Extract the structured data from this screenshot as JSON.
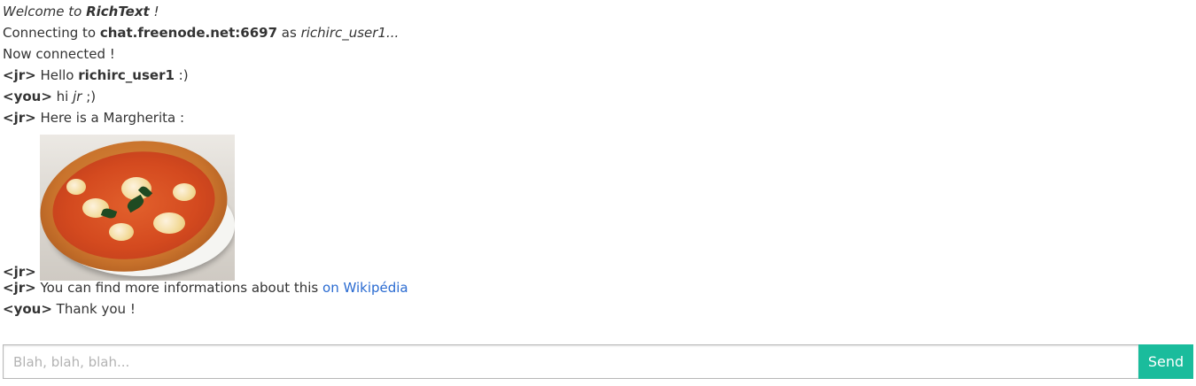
{
  "messages": {
    "welcome": {
      "prefix": "Welcome to ",
      "app_name": "RichText",
      "suffix": " !"
    },
    "connecting": {
      "prefix": "Connecting to ",
      "server": "chat.freenode.net:6697",
      "middle": " as ",
      "username": "richirc_user1",
      "suffix": "..."
    },
    "connected": {
      "text": "Now connected !"
    },
    "msg1": {
      "nick": "<jr>",
      "pre": " Hello ",
      "bold": "richirc_user1",
      "post": " :)"
    },
    "msg2": {
      "nick": "<you>",
      "pre": " hi ",
      "italic": "jr",
      "post": " ;)"
    },
    "msg3": {
      "nick": "<jr>",
      "text": " Here is a Margherita :"
    },
    "msg4": {
      "nick": "<jr>"
    },
    "msg5": {
      "nick": "<jr>",
      "text": " You can find more informations about this ",
      "link": "on Wikipédia"
    },
    "msg6": {
      "nick": "<you>",
      "text": " Thank you !"
    }
  },
  "composer": {
    "placeholder": "Blah, blah, blah...",
    "value": "",
    "send_label": "Send"
  },
  "colors": {
    "send_button": "#1abc9c",
    "link": "#2a6bd1",
    "text": "#333333"
  }
}
